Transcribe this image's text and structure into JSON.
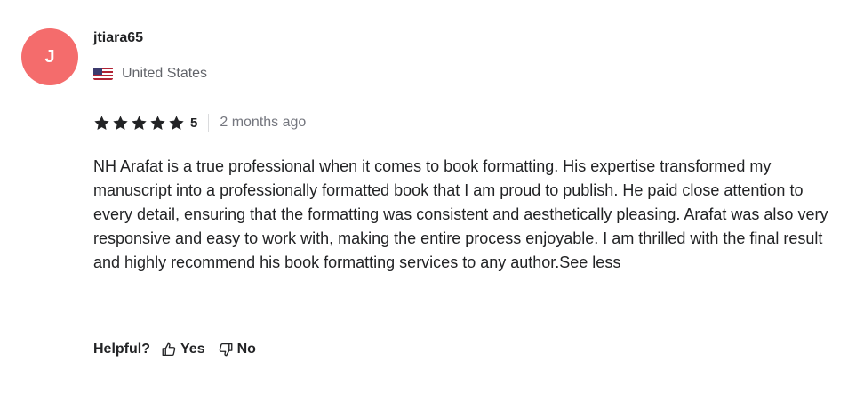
{
  "reviewer": {
    "avatar_initial": "J",
    "avatar_color": "#f46c6c",
    "username": "jtiara65",
    "country": "United States",
    "flag_icon": "us-flag-icon"
  },
  "rating": {
    "stars": 5,
    "value": "5",
    "time_ago": "2 months ago",
    "star_color": "#222325"
  },
  "review": {
    "text": "NH Arafat is a true professional when it comes to book formatting. His expertise transformed my manuscript into a professionally formatted book that I am proud to publish. He paid close attention to every detail, ensuring that the formatting was consistent and aesthetically pleasing. Arafat was also very responsive and easy to work with, making the entire process enjoyable. I am thrilled with the final result and highly recommend his book formatting services to any author.",
    "toggle_label": "See less"
  },
  "helpful": {
    "label": "Helpful?",
    "yes_label": "Yes",
    "no_label": "No",
    "yes_icon": "thumbs-up-icon",
    "no_icon": "thumbs-down-icon"
  }
}
